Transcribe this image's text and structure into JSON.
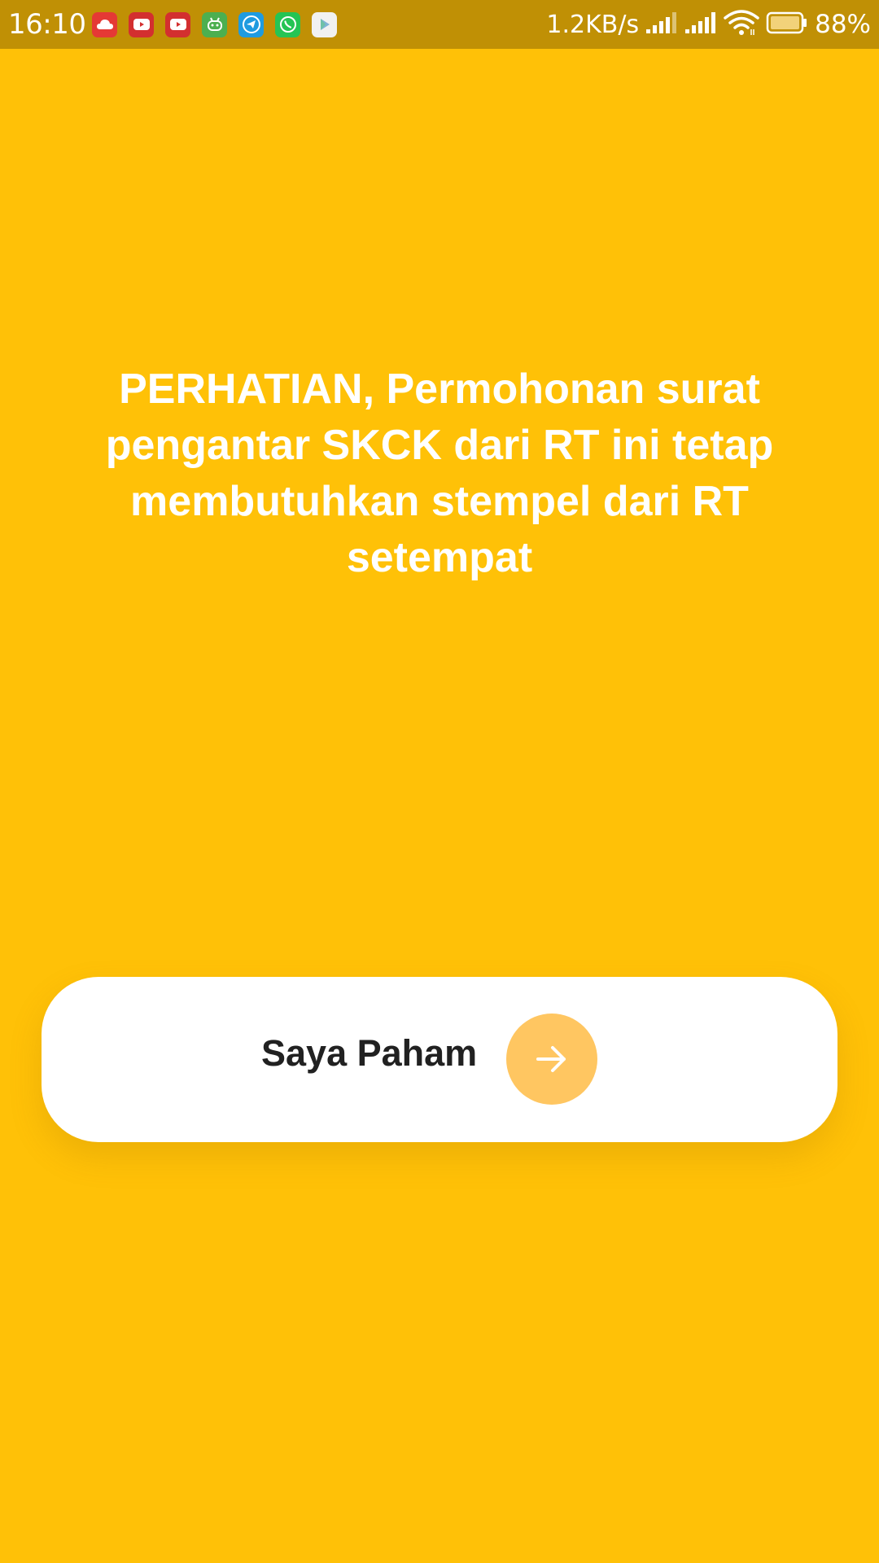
{
  "status_bar": {
    "time": "16:10",
    "network_speed": "1.2KB/s",
    "battery_percent": "88%",
    "notification_icons": [
      {
        "name": "cloud-app-icon",
        "color": "#E53935"
      },
      {
        "name": "youtube-icon",
        "color": "#D32F2F"
      },
      {
        "name": "youtube-icon",
        "color": "#D32F2F"
      },
      {
        "name": "android-app-icon",
        "color": "#4CAF50"
      },
      {
        "name": "telegram-icon",
        "color": "#1E9BE0"
      },
      {
        "name": "whatsapp-icon",
        "color": "#25C454"
      },
      {
        "name": "play-store-icon",
        "color": "#F1F1F1"
      }
    ]
  },
  "message": {
    "text": "PERHATIAN, Permohonan surat pengantar SKCK dari RT ini tetap membutuhkan stempel dari RT setempat"
  },
  "confirm_button": {
    "label": "Saya Paham",
    "icon": "arrow-right-icon"
  },
  "colors": {
    "background": "#FFC107",
    "status_bar": "#C09005",
    "button_bg": "#FFFFFF",
    "arrow_circle": "#FFC661",
    "text_primary": "#212121"
  }
}
